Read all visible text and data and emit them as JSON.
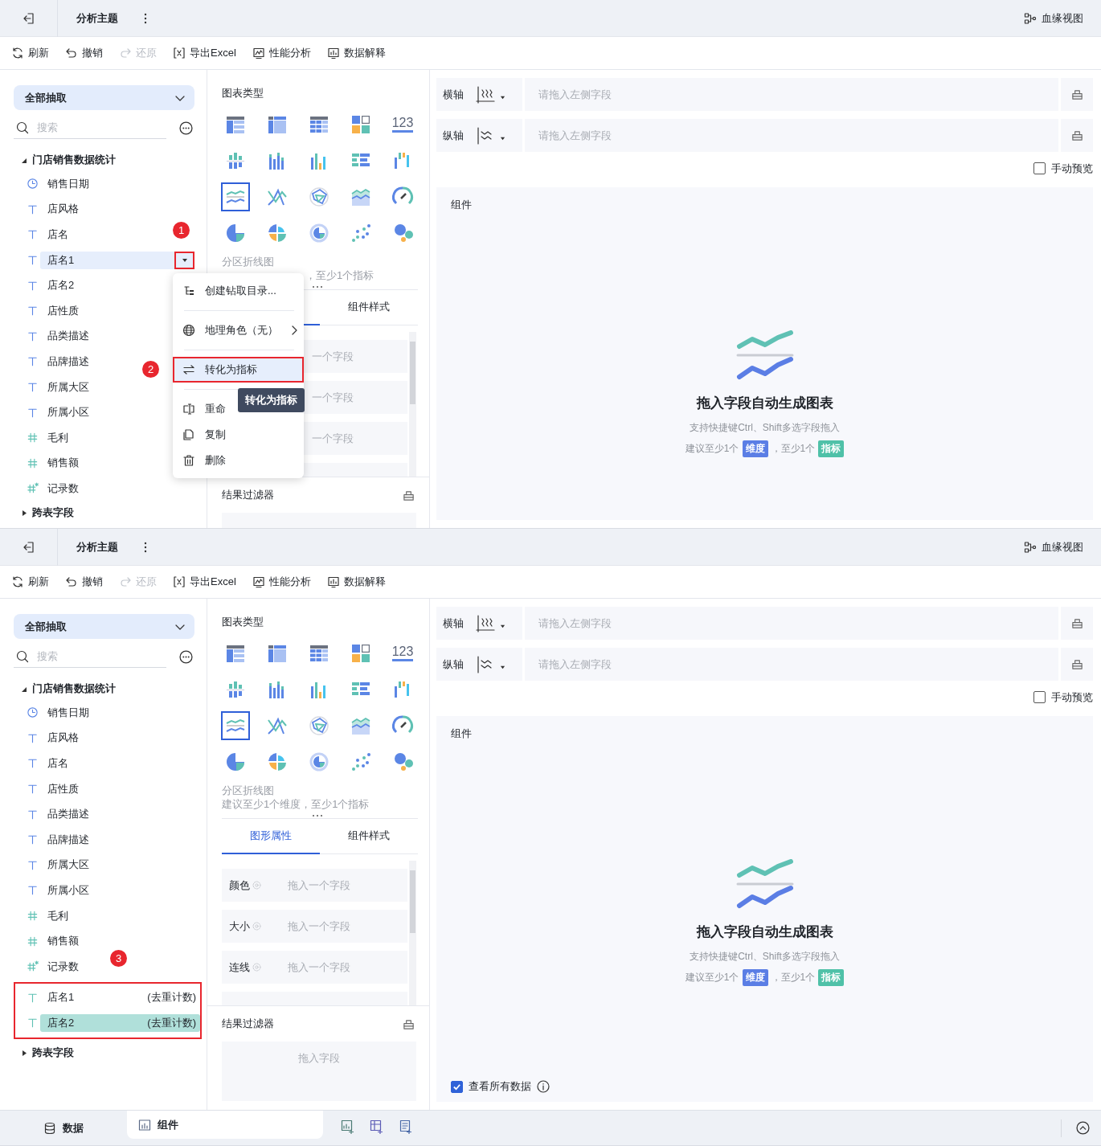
{
  "screens": [
    {
      "topbar": {
        "title": "分析主题",
        "lineage": "血缘视图"
      },
      "toolbar": [
        {
          "label": "刷新",
          "disabled": false
        },
        {
          "label": "撤销",
          "disabled": false
        },
        {
          "label": "还原",
          "disabled": true
        },
        {
          "label": "导出Excel",
          "disabled": false
        },
        {
          "label": "性能分析",
          "disabled": false
        },
        {
          "label": "数据解释",
          "disabled": false
        }
      ],
      "data_panel": {
        "source": "全部抽取",
        "search": {
          "placeholder": "搜索"
        },
        "tree": [
          {
            "label": "门店销售数据统计",
            "expanded": true,
            "children": [
              {
                "kind": "date",
                "label": "销售日期",
                "selected": false
              },
              {
                "kind": "text",
                "label": "店风格",
                "selected": false
              },
              {
                "kind": "text",
                "label": "店名",
                "selected": false,
                "badge": "1"
              },
              {
                "kind": "text",
                "label": "店名1",
                "selected": true,
                "menu": {
                  "button_outlined": true,
                  "items": [
                    {
                      "kind": "item",
                      "label": "创建钻取目录...",
                      "highlighted": false,
                      "outlined": false
                    },
                    {
                      "kind": "divider"
                    },
                    {
                      "kind": "submenu",
                      "label": "地理角色（无）",
                      "highlighted": false,
                      "outlined": false
                    },
                    {
                      "kind": "divider"
                    },
                    {
                      "kind": "item",
                      "label": "转化为指标",
                      "highlighted": true,
                      "outlined": true,
                      "badge": "2",
                      "tooltip": "转化为指标"
                    },
                    {
                      "kind": "divider"
                    },
                    {
                      "kind": "item",
                      "label": "重命",
                      "highlighted": false,
                      "outlined": false
                    },
                    {
                      "kind": "item",
                      "label": "复制",
                      "highlighted": false,
                      "outlined": false
                    },
                    {
                      "kind": "item",
                      "label": "删除",
                      "highlighted": false,
                      "outlined": false
                    }
                  ]
                }
              },
              {
                "kind": "text",
                "label": "店名2",
                "selected": false
              },
              {
                "kind": "text",
                "label": "店性质",
                "selected": false
              },
              {
                "kind": "text",
                "label": "品类描述",
                "selected": false
              },
              {
                "kind": "text",
                "label": "品牌描述",
                "selected": false
              },
              {
                "kind": "text",
                "label": "所属大区",
                "selected": false
              },
              {
                "kind": "text",
                "label": "所属小区",
                "selected": false
              },
              {
                "kind": "number",
                "label": "毛利",
                "selected": false
              },
              {
                "kind": "number",
                "label": "销售额",
                "selected": false
              },
              {
                "kind": "count",
                "label": "记录数",
                "selected": false
              }
            ]
          },
          {
            "label": "跨表字段",
            "expanded": false
          }
        ]
      },
      "chart_panel": {
        "title": "图表类型",
        "chart_types": [
          {
            "selected": false
          },
          {
            "selected": false
          },
          {
            "selected": false
          },
          {
            "selected": false
          },
          {
            "selected": false,
            "text": "123"
          },
          {
            "selected": false
          },
          {
            "selected": false
          },
          {
            "selected": false
          },
          {
            "selected": false
          },
          {
            "selected": false
          },
          {
            "selected": true
          },
          {
            "selected": false
          },
          {
            "selected": false
          },
          {
            "selected": false
          },
          {
            "selected": false
          },
          {
            "selected": false
          },
          {
            "selected": false
          },
          {
            "selected": false
          },
          {
            "selected": false
          },
          {
            "selected": false
          }
        ],
        "chart_name": "分区折线图",
        "hint": "，至少1个指标",
        "tabs": [
          {
            "selected": true
          },
          {
            "label": "组件样式",
            "selected": false
          }
        ],
        "properties": [
          {
            "kind": "slot",
            "placeholder": "一个字段"
          },
          {
            "kind": "slot",
            "placeholder": "一个字段"
          },
          {
            "kind": "slot",
            "placeholder": "一个字段"
          },
          {
            "kind": "slot"
          }
        ],
        "filter": {
          "title": "结果过滤器"
        }
      },
      "canvas": {
        "axes": [
          {
            "label": "横轴",
            "placeholder": "请拖入左侧字段"
          },
          {
            "label": "纵轴",
            "placeholder": "请拖入左侧字段"
          }
        ],
        "manual_preview": {
          "label": "手动预览",
          "checked": false
        },
        "component": {
          "title": "组件",
          "empty_title": "拖入字段自动生成图表",
          "empty_sub": "支持快捷键Ctrl、Shift多选字段拖入",
          "hint_parts": [
            {
              "kind": "text",
              "text": "建议至少1个"
            },
            {
              "kind": "tag",
              "text": "维度",
              "color": "#5b7ee5"
            },
            {
              "kind": "text",
              "text": "，至少1个"
            },
            {
              "kind": "tag",
              "text": "指标",
              "color": "#4fc1a8"
            }
          ]
        }
      }
    },
    {
      "topbar": {
        "title": "分析主题",
        "lineage": "血缘视图"
      },
      "toolbar": [
        {
          "label": "刷新",
          "disabled": false
        },
        {
          "label": "撤销",
          "disabled": false
        },
        {
          "label": "还原",
          "disabled": true
        },
        {
          "label": "导出Excel",
          "disabled": false
        },
        {
          "label": "性能分析",
          "disabled": false
        },
        {
          "label": "数据解释",
          "disabled": false
        }
      ],
      "data_panel": {
        "source": "全部抽取",
        "search": {
          "placeholder": "搜索"
        },
        "tree": [
          {
            "label": "门店销售数据统计",
            "expanded": true,
            "children": [
              {
                "kind": "date",
                "label": "销售日期",
                "selected": false
              },
              {
                "kind": "text",
                "label": "店风格",
                "selected": false
              },
              {
                "kind": "text",
                "label": "店名",
                "selected": false
              },
              {
                "kind": "text",
                "label": "店性质",
                "selected": false
              },
              {
                "kind": "text",
                "label": "品类描述",
                "selected": false
              },
              {
                "kind": "text",
                "label": "品牌描述",
                "selected": false
              },
              {
                "kind": "text",
                "label": "所属大区",
                "selected": false
              },
              {
                "kind": "text",
                "label": "所属小区",
                "selected": false
              },
              {
                "kind": "number",
                "label": "毛利",
                "selected": false
              },
              {
                "kind": "number",
                "label": "销售额",
                "selected": false
              },
              {
                "kind": "count",
                "label": "记录数",
                "selected": false
              },
              {
                "kind": "measure-text",
                "label": "店名1",
                "suffix": "(去重计数)",
                "selected": false,
                "outlined": true,
                "badge": "3"
              },
              {
                "kind": "measure-text",
                "label": "店名2",
                "suffix": "(去重计数)",
                "selected": true,
                "outlined": true
              }
            ]
          },
          {
            "label": "跨表字段",
            "expanded": false
          }
        ]
      },
      "chart_panel": {
        "title": "图表类型",
        "chart_types": [
          {
            "selected": false
          },
          {
            "selected": false
          },
          {
            "selected": false
          },
          {
            "selected": false
          },
          {
            "selected": false,
            "text": "123"
          },
          {
            "selected": false
          },
          {
            "selected": false
          },
          {
            "selected": false
          },
          {
            "selected": false
          },
          {
            "selected": false
          },
          {
            "selected": true
          },
          {
            "selected": false
          },
          {
            "selected": false
          },
          {
            "selected": false
          },
          {
            "selected": false
          },
          {
            "selected": false
          },
          {
            "selected": false
          },
          {
            "selected": false
          },
          {
            "selected": false
          },
          {
            "selected": false
          }
        ],
        "chart_name": "分区折线图",
        "hint": "建议至少1个维度，至少1个指标",
        "tabs": [
          {
            "label": "图形属性",
            "selected": true
          },
          {
            "label": "组件样式",
            "selected": false
          }
        ],
        "properties": [
          {
            "kind": "slot",
            "label": "颜色",
            "placeholder": "拖入一个字段"
          },
          {
            "kind": "slot",
            "label": "大小",
            "placeholder": "拖入一个字段"
          },
          {
            "kind": "slot",
            "label": "连线",
            "placeholder": "拖入一个字段"
          },
          {
            "kind": "slot"
          }
        ],
        "filter": {
          "title": "结果过滤器",
          "placeholder": "拖入字段"
        }
      },
      "canvas": {
        "axes": [
          {
            "label": "横轴",
            "placeholder": "请拖入左侧字段"
          },
          {
            "label": "纵轴",
            "placeholder": "请拖入左侧字段"
          }
        ],
        "manual_preview": {
          "label": "手动预览",
          "checked": false
        },
        "component": {
          "title": "组件",
          "empty_title": "拖入字段自动生成图表",
          "empty_sub": "支持快捷键Ctrl、Shift多选字段拖入",
          "hint_parts": [
            {
              "kind": "text",
              "text": "建议至少1个"
            },
            {
              "kind": "tag",
              "text": "维度",
              "color": "#5b7ee5"
            },
            {
              "kind": "text",
              "text": "，至少1个"
            },
            {
              "kind": "tag",
              "text": "指标",
              "color": "#4fc1a8"
            }
          ]
        },
        "view_all": {
          "label": "查看所有数据",
          "checked": true
        }
      },
      "bottom_bar": {
        "tabs": [
          {
            "label": "数据",
            "selected": false
          },
          {
            "label": "组件",
            "selected": true
          }
        ]
      }
    }
  ]
}
